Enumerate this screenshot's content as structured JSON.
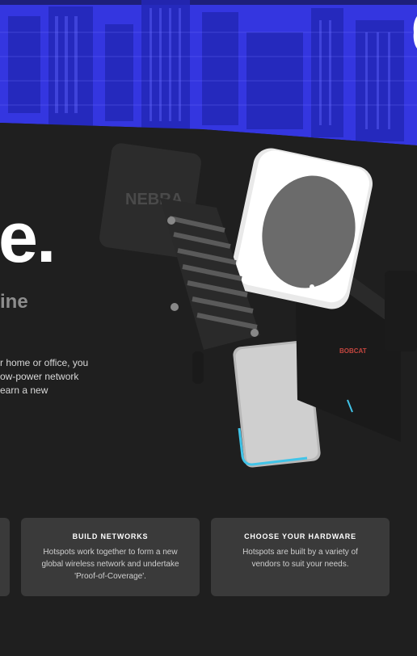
{
  "hero": {
    "big_glyph": "e.",
    "subline_fragment": "ine",
    "intro_lines": [
      "r home or office, you",
      "ow-power network",
      "earn a new"
    ]
  },
  "devices": {
    "brand_a": "NEBRA",
    "brand_b": "BOBCAT"
  },
  "features": [
    {
      "title": "BUILD NETWORKS",
      "body": "Hotspots work together to form a new global wireless network and undertake 'Proof-of-Coverage'."
    },
    {
      "title": "CHOOSE YOUR HARDWARE",
      "body": "Hotspots are built by a variety of vendors to suit your needs."
    }
  ],
  "colors": {
    "hero_blue": "#3a3ee6",
    "page_bg": "#1f1f1f",
    "card_bg": "#3a3a3a",
    "accent_cyan": "#41c4e8"
  }
}
